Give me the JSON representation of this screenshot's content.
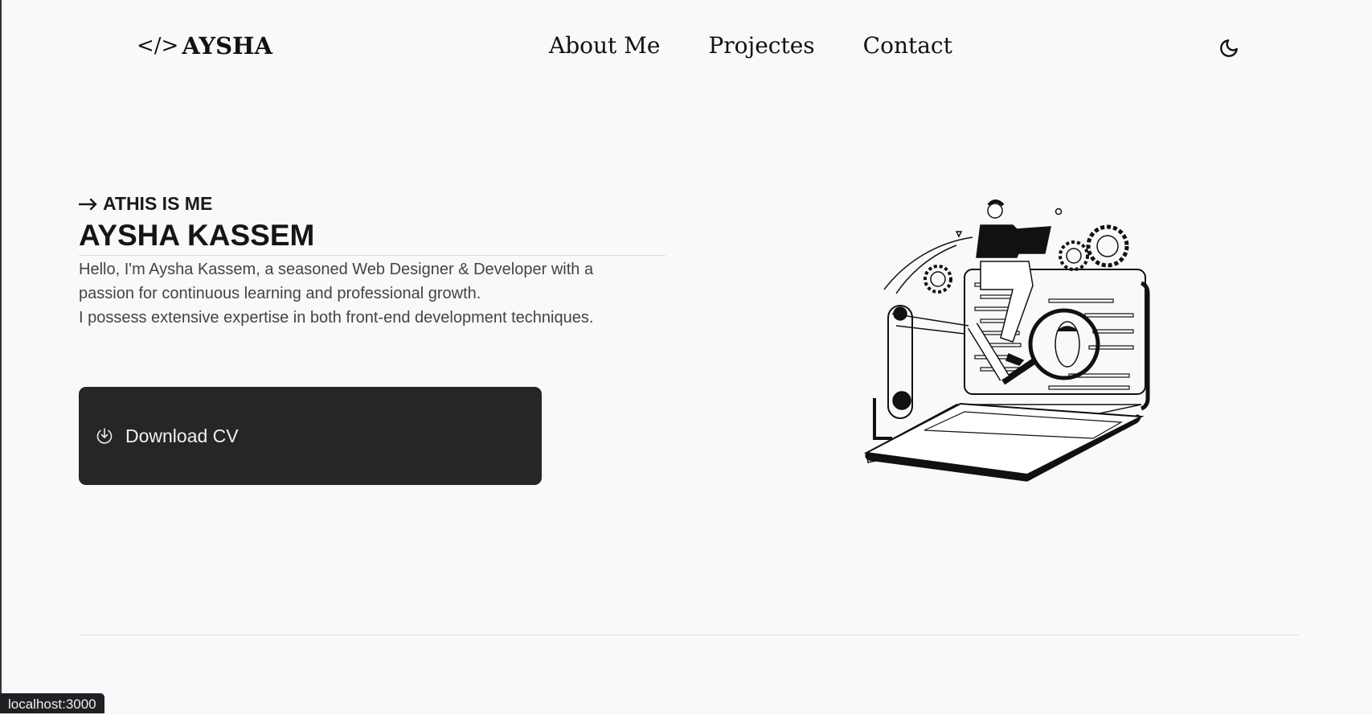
{
  "header": {
    "logo_icon": "code-icon",
    "logo_code": "</>",
    "logo_text": "AYSHA",
    "nav": [
      {
        "label": "About Me"
      },
      {
        "label": "Projectes"
      },
      {
        "label": "Contact"
      }
    ],
    "theme_icon": "moon-icon"
  },
  "hero": {
    "kicker_icon": "arrow-right-icon",
    "kicker": "ATHIS IS ME",
    "name": "AYSHA KASSEM",
    "description": [
      "Hello, I'm Aysha Kassem, a seasoned Web Designer & Developer with a",
      "passion for continuous learning and professional growth.",
      "I possess extensive expertise in both front-end development techniques."
    ],
    "download_label": "Download CV",
    "download_icon": "download-icon"
  },
  "status_bar": {
    "url": "localhost:3000"
  }
}
